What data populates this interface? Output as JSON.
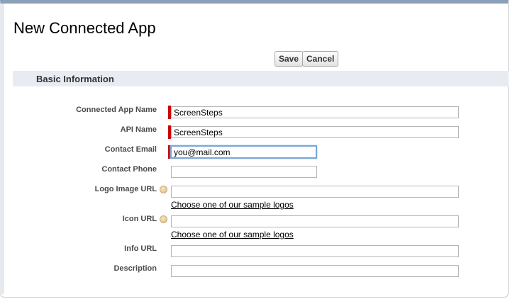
{
  "page": {
    "title": "New Connected App"
  },
  "toolbar": {
    "save_label": "Save",
    "cancel_label": "Cancel"
  },
  "section": {
    "title": "Basic Information"
  },
  "fields": {
    "connected_app_name": {
      "label": "Connected App Name",
      "value": "ScreenSteps",
      "required": true
    },
    "api_name": {
      "label": "API Name",
      "value": "ScreenSteps",
      "required": true
    },
    "contact_email": {
      "label": "Contact Email",
      "value": "you@mail.com",
      "required": true
    },
    "contact_phone": {
      "label": "Contact Phone",
      "value": ""
    },
    "logo_image_url": {
      "label": "Logo Image URL",
      "value": "",
      "link": "Choose one of our sample logos"
    },
    "icon_url": {
      "label": "Icon URL",
      "value": "",
      "link": "Choose one of our sample logos"
    },
    "info_url": {
      "label": "Info URL",
      "value": ""
    },
    "description": {
      "label": "Description",
      "value": ""
    }
  },
  "icons": {
    "help": "help-icon",
    "required": "required-marker"
  },
  "colors": {
    "required": "#cc0000",
    "section_bg": "#e8ebf2",
    "focus": "#7aa7d6"
  }
}
